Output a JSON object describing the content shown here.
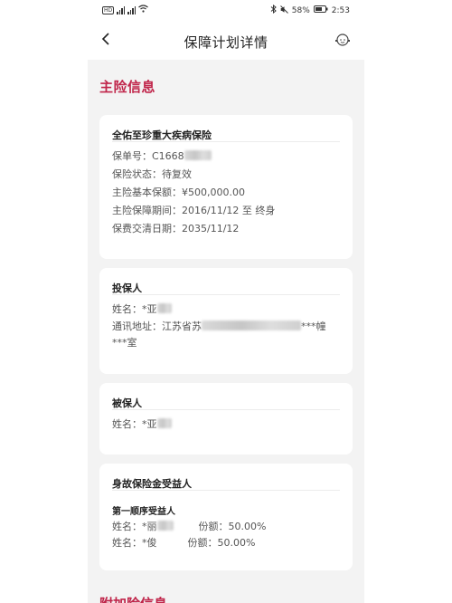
{
  "status": {
    "carrier_left": "HD",
    "battery": "58%",
    "time": "2:53"
  },
  "nav": {
    "title": "保障计划详情"
  },
  "main_section_title": "主险信息",
  "policy_card": {
    "title": "全佑至珍重大疾病保险",
    "rows": [
      {
        "label": "保单号：",
        "value": "C1668"
      },
      {
        "label": "保险状态：",
        "value": "待复效"
      },
      {
        "label": "主险基本保额：",
        "value": "¥500,000.00"
      },
      {
        "label": "主险保障期间：",
        "value": "2016/11/12 至 终身"
      },
      {
        "label": "保费交清日期：",
        "value": "2035/11/12"
      }
    ]
  },
  "applicant_card": {
    "title": "投保人",
    "name_label": "姓名：",
    "name_value": "*亚",
    "address_label": "通讯地址：",
    "address_value": "江苏省苏",
    "address_tail": "***幢",
    "address_line2": "***室"
  },
  "insured_card": {
    "title": "被保人",
    "name_label": "姓名：",
    "name_value": "*亚"
  },
  "beneficiary_card": {
    "title": "身故保险金受益人",
    "order_label": "第一顺序受益人",
    "rows": [
      {
        "name_label": "姓名：",
        "name": "*丽",
        "share_label": "份额：",
        "share": "50.00%"
      },
      {
        "name_label": "姓名：",
        "name": "*俊",
        "share_label": "份额：",
        "share": "50.00%"
      }
    ]
  },
  "next_section_title": "附加险信息"
}
